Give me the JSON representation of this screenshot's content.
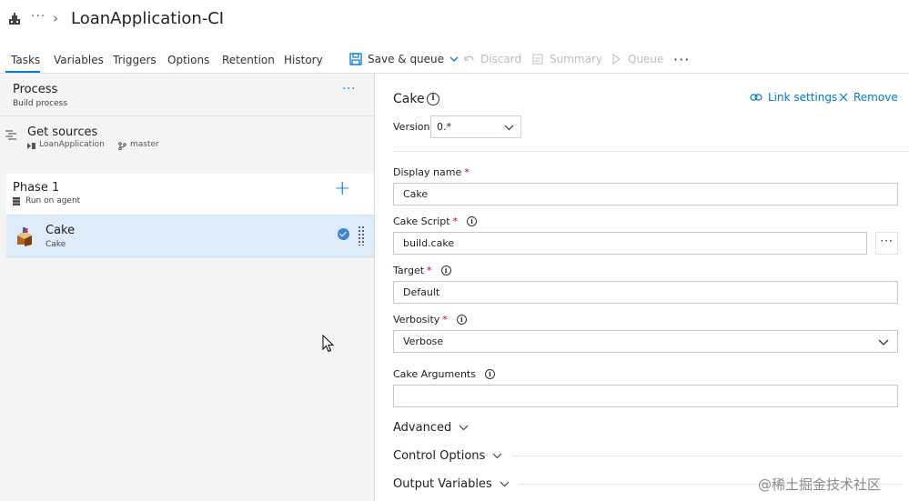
{
  "header": {
    "title": "LoanApplication-CI",
    "ellipsis": "···",
    "chevron": "›"
  },
  "tabs": [
    {
      "label": "Tasks",
      "active": true
    },
    {
      "label": "Variables"
    },
    {
      "label": "Triggers"
    },
    {
      "label": "Options"
    },
    {
      "label": "Retention"
    },
    {
      "label": "History"
    }
  ],
  "toolbar": {
    "save_queue": "Save & queue",
    "discard": "Discard",
    "summary": "Summary",
    "queue": "Queue",
    "more": "···"
  },
  "process": {
    "title": "Process",
    "subtitle": "Build process",
    "more": "···"
  },
  "get_sources": {
    "title": "Get sources",
    "repo": "LoanApplication",
    "branch": "master"
  },
  "phase": {
    "title": "Phase 1",
    "subtitle": "Run on agent",
    "add": "+"
  },
  "task": {
    "title": "Cake",
    "subtitle": "Cake"
  },
  "detail": {
    "title": "Cake",
    "info_glyph": "i",
    "link_settings": "Link settings",
    "remove": "Remove",
    "version_label": "Version",
    "version_value": "0.*",
    "fields": {
      "display_name": {
        "label": "Display name",
        "value": "Cake"
      },
      "cake_script": {
        "label": "Cake Script",
        "value": "build.cake"
      },
      "target": {
        "label": "Target",
        "value": "Default"
      },
      "verbosity": {
        "label": "Verbosity",
        "value": "Verbose"
      },
      "cake_arguments": {
        "label": "Cake Arguments",
        "value": ""
      }
    },
    "required_mark": "*",
    "browse": "···",
    "sections": {
      "advanced": "Advanced",
      "control_options": "Control Options",
      "output_variables": "Output Variables"
    }
  },
  "watermark": "@稀土掘金技术社区",
  "colors": {
    "accent": "#0078d4",
    "selected_row": "#deecf9",
    "required": "#cc0000"
  }
}
